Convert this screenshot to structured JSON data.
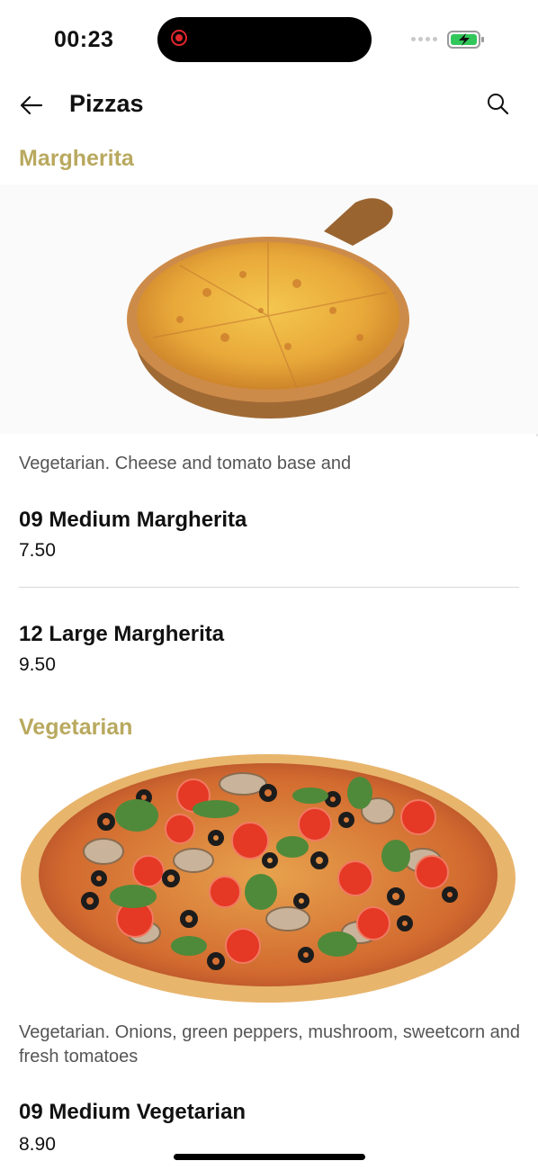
{
  "status": {
    "time": "00:23"
  },
  "header": {
    "title": "Pizzas"
  },
  "sections": [
    {
      "title": "Margherita",
      "description": "Vegetarian. Cheese and tomato base and",
      "items": [
        {
          "name": "09 Medium Margherita",
          "price": "7.50"
        },
        {
          "name": "12 Large Margherita",
          "price": "9.50"
        }
      ]
    },
    {
      "title": "Vegetarian",
      "description": "Vegetarian. Onions, green peppers, mushroom, sweetcorn and fresh tomatoes",
      "items": [
        {
          "name": "09 Medium Vegetarian",
          "price": "8.90"
        }
      ]
    }
  ],
  "colors": {
    "accent": "#b9a95f",
    "battery_fill": "#32c75a",
    "recording": "#e0262c"
  },
  "icons": [
    "back-arrow-icon",
    "search-icon",
    "battery-charging-icon",
    "recording-icon"
  ]
}
